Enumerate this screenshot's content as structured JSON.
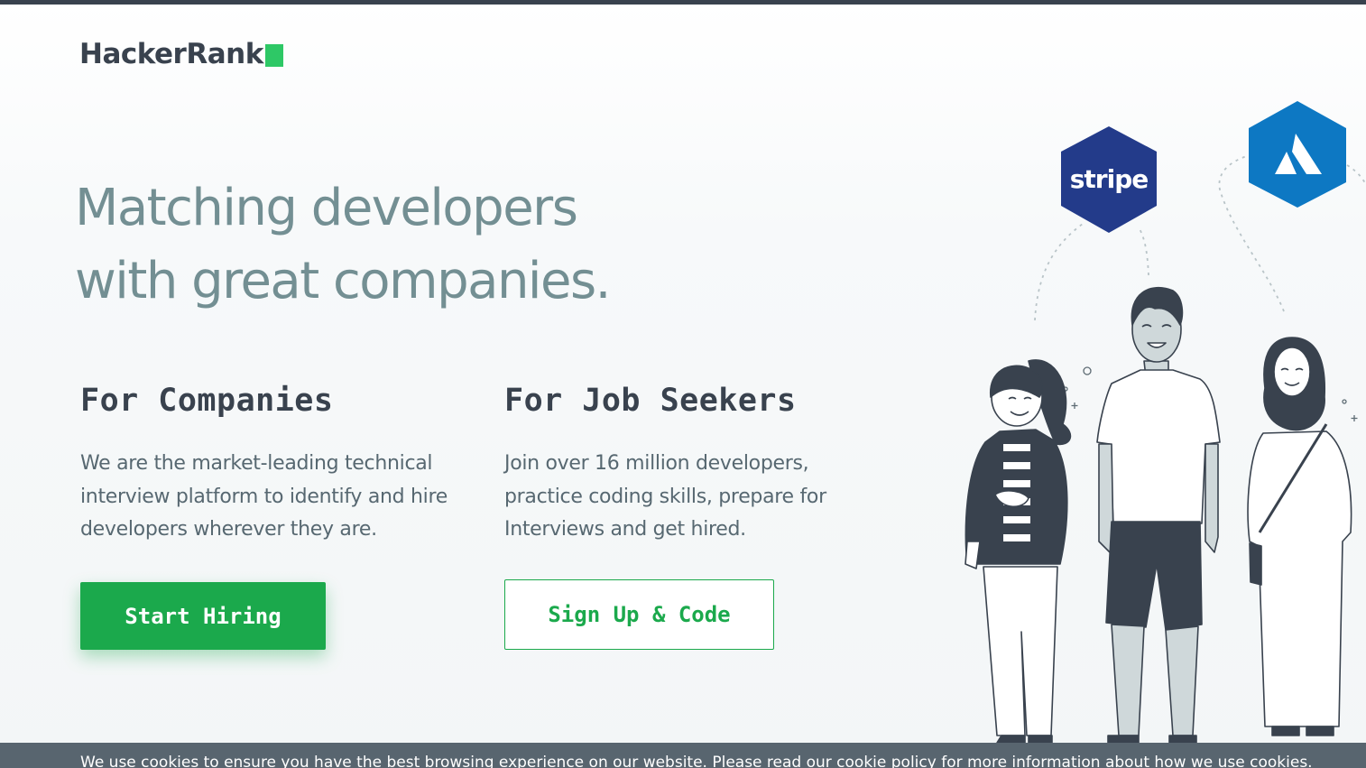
{
  "brand": {
    "name": "HackerRank",
    "accent_color": "#2ec866",
    "dark_color": "#39424e"
  },
  "hero": {
    "headline_line1": "Matching developers",
    "headline_line2": "with great companies."
  },
  "companies": {
    "title": "For Companies",
    "description": "We are the market-leading technical interview platform to identify and hire developers wherever they are.",
    "button_label": "Start Hiring"
  },
  "seekers": {
    "title": "For Job Seekers",
    "description": "Join over 16 million developers, practice coding skills, prepare for Interviews and get hired.",
    "button_label": "Sign Up & Code"
  },
  "illustration": {
    "logos": [
      {
        "name": "stripe",
        "label": "stripe",
        "color": "#233b8a"
      },
      {
        "name": "atlassian",
        "color": "#0d78c3"
      }
    ],
    "icons": [
      "person-woman-icon",
      "person-man-icon",
      "person-hijab-icon"
    ]
  },
  "cookie": {
    "text": "We use cookies to ensure you have the best browsing experience on our website. Please read our cookie policy for more information about how we use cookies."
  },
  "colors": {
    "primary_green": "#1ba94c",
    "headline": "#738f93",
    "body_text": "#576871",
    "cookie_bg": "#58656f"
  }
}
